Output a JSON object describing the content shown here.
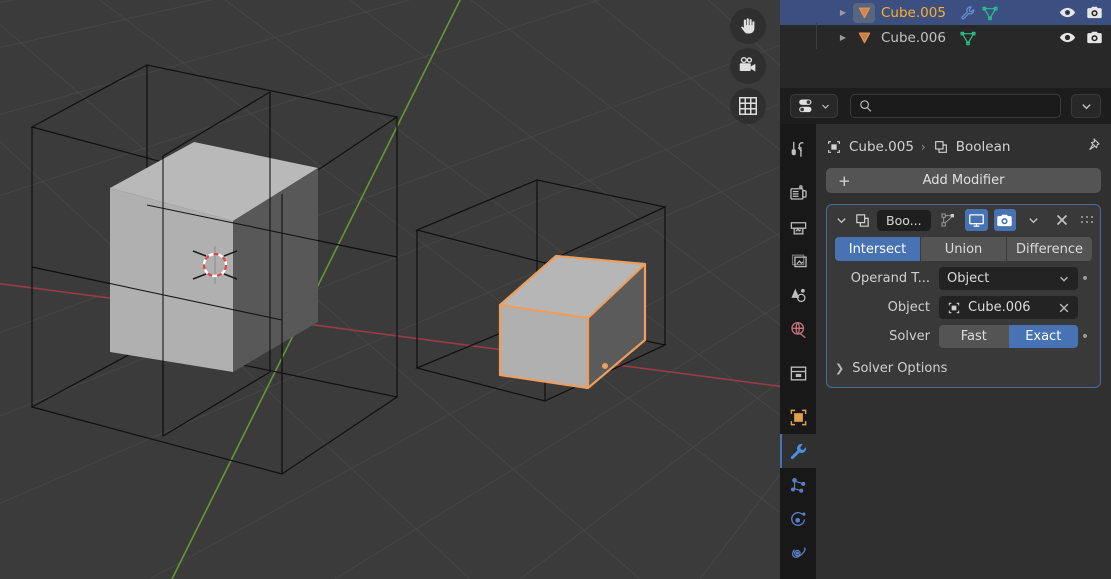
{
  "viewport": {
    "name": "3d-viewport",
    "background_color": "#3b3b3b",
    "grid_color": "#4a4a4a",
    "x_axis_color": "#a33b4a",
    "y_axis_color": "#6a9e34",
    "selected_outline_color": "#ed9e5c",
    "object_fill_color": "#a8a8a8",
    "wire_color": "#121212",
    "cursor_label": "3d-cursor",
    "gizmos": [
      {
        "name": "hand-icon",
        "label": "Move View"
      },
      {
        "name": "camera-icon",
        "label": "Camera View"
      },
      {
        "name": "grid-icon",
        "label": "Toggle Orthographic"
      }
    ]
  },
  "outliner": {
    "rows": [
      {
        "name": "Cube.005",
        "selected": true,
        "active": true,
        "object_icon": "mesh-object-icon",
        "data_icons": [
          "modifier-wrench-icon",
          "mesh-data-icon"
        ],
        "restrict_icons": [
          "hide-viewport-eye-icon",
          "disable-render-camera-icon"
        ]
      },
      {
        "name": "Cube.006",
        "selected": false,
        "active": false,
        "object_icon": "mesh-object-icon",
        "data_icons": [
          "mesh-data-icon"
        ],
        "restrict_icons": [
          "hide-viewport-eye-icon",
          "disable-render-camera-icon"
        ]
      }
    ],
    "selection_color": "#3b5081",
    "active_text_color": "#ffaf29"
  },
  "properties": {
    "topbar": {
      "filter_label": "filter-toggle",
      "search_placeholder": "",
      "search_value": "",
      "search_icon": "search-icon",
      "dropdown_icon": "chevron-down-icon"
    },
    "tabs": [
      {
        "name": "tool",
        "icon": "tool-screwdriver-wrench-icon",
        "active": false,
        "color": "#bdbdbd"
      },
      {
        "name": "render",
        "icon": "render-camera-back-icon",
        "active": false,
        "color": "#bdbdbd"
      },
      {
        "name": "output",
        "icon": "output-printer-icon",
        "active": false,
        "color": "#bdbdbd"
      },
      {
        "name": "view-layer",
        "icon": "view-layer-images-icon",
        "active": false,
        "color": "#bdbdbd"
      },
      {
        "name": "scene",
        "icon": "scene-cone-sphere-icon",
        "active": false,
        "color": "#bdbdbd"
      },
      {
        "name": "world",
        "icon": "world-globe-icon",
        "active": false,
        "color": "#c1707c"
      },
      {
        "name": "collection",
        "icon": "collection-box-icon",
        "active": false,
        "color": "#bdbdbd"
      },
      {
        "name": "object",
        "icon": "object-square-corners-icon",
        "active": false,
        "color": "#e2a04d"
      },
      {
        "name": "modifiers",
        "icon": "wrench-icon",
        "active": true,
        "color": "#4a90e2"
      },
      {
        "name": "particles",
        "icon": "particles-icon",
        "active": false,
        "color": "#5a7fc4"
      },
      {
        "name": "physics",
        "icon": "physics-orbit-icon",
        "active": false,
        "color": "#5a7fc4"
      },
      {
        "name": "constraints",
        "icon": "object-constraints-icon",
        "active": false,
        "color": "#5a7fc4"
      }
    ],
    "breadcrumb": {
      "object_icon": "object-data-icon",
      "object_name": "Cube.005",
      "separator": "›",
      "modifier_icon": "modifier-boolean-icon",
      "modifier_name": "Boolean",
      "pin_icon": "pin-icon"
    },
    "add_modifier": {
      "label": "Add Modifier",
      "plus_icon": "plus-icon"
    }
  },
  "modifier": {
    "expand_icon": "chevron-down-icon",
    "type_icon": "modifier-boolean-icon",
    "name_value": "Boo...",
    "name_full": "Boolean",
    "header_toggles": [
      {
        "name": "edit-mode-display-toggle",
        "icon": "edit-mode-icon",
        "on": false
      },
      {
        "name": "realtime-display-toggle",
        "icon": "monitor-icon",
        "on": true
      },
      {
        "name": "render-display-toggle",
        "icon": "camera-icon",
        "on": true
      }
    ],
    "extras_icon": "chevron-down-icon",
    "close_icon": "x-icon",
    "drag_icon": "drag-dots-icon",
    "operation": {
      "label": "operation",
      "options": [
        "Intersect",
        "Union",
        "Difference"
      ],
      "selected": "Intersect"
    },
    "operand_type": {
      "label": "Operand T...",
      "label_full": "Operand Type",
      "value": "Object",
      "dropdown_icon": "chevron-down-icon",
      "animate_icon": "animate-dot-icon"
    },
    "object": {
      "label": "Object",
      "value": "Cube.006",
      "value_icon": "object-data-icon",
      "clear_icon": "x-icon"
    },
    "solver": {
      "label": "Solver",
      "options": [
        "Fast",
        "Exact"
      ],
      "selected": "Exact",
      "animate_icon": "animate-dot-icon"
    },
    "solver_options": {
      "label": "Solver Options",
      "expanded": false,
      "disclosure_icon": "chevron-right-icon"
    },
    "accent_color": "#4772b3",
    "panel_outline_color": "#4b6a9b"
  }
}
